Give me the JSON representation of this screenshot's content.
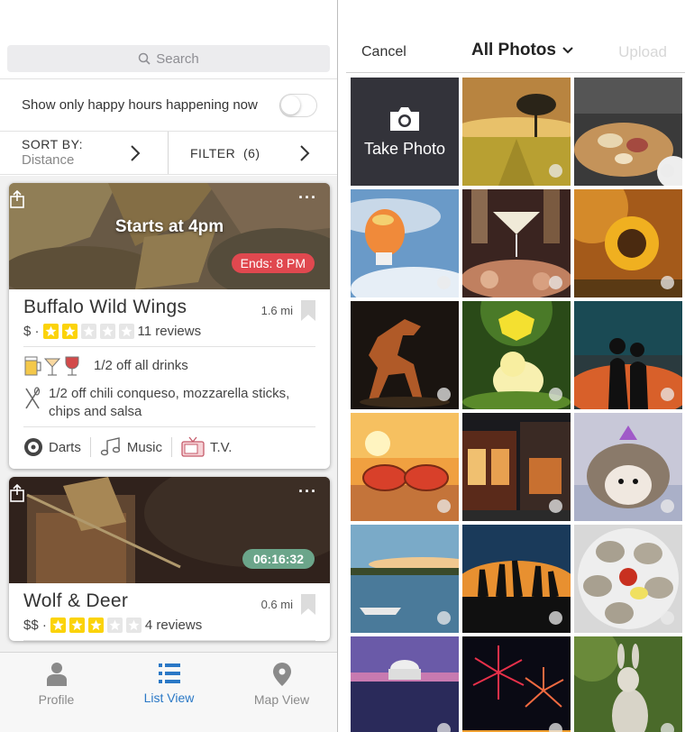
{
  "left": {
    "search": {
      "placeholder": "Search"
    },
    "toggle": {
      "label": "Show only happy hours happening now",
      "on": false
    },
    "sort": {
      "label": "SORT BY:",
      "value": "Distance"
    },
    "filter": {
      "label": "FILTER",
      "count": "(6)"
    },
    "cards": [
      {
        "overlay": "Starts at 4pm",
        "badge": "Ends: 8 PM",
        "name": "Buffalo Wild Wings",
        "distance": "1.6 mi",
        "price": "$ ·",
        "rating": 2,
        "reviews": "11 reviews",
        "deals": [
          "1/2 off all drinks",
          "1/2 off chili conqueso, mozzarella sticks, chips and salsa"
        ],
        "amenities": [
          "Darts",
          "Music",
          "T.V."
        ]
      },
      {
        "badge": "06:16:32",
        "name": "Wolf & Deer",
        "distance": "0.6 mi",
        "price": "$$ ·",
        "rating": 3,
        "reviews": "4 reviews"
      }
    ],
    "tabs": [
      {
        "label": "Profile",
        "icon": "person-icon"
      },
      {
        "label": "List View",
        "icon": "list-icon",
        "active": true
      },
      {
        "label": "Map View",
        "icon": "map-pin-icon"
      }
    ]
  },
  "right": {
    "cancel": "Cancel",
    "title": "All Photos",
    "upload": "Upload",
    "take_photo": "Take Photo",
    "photos": [
      "wheat field with tree at sunset",
      "charcuterie board",
      "inflatable baby balloon",
      "cocktails and food",
      "sunflower",
      "dinosaur model",
      "duckling under daffodil",
      "couple silhouette at sunset",
      "sunglasses on beach",
      "restaurant facade at night",
      "hedgehog with party hat",
      "boats on lake",
      "crowd at sunset",
      "oysters on plate",
      "Jefferson memorial at dusk",
      "fireworks",
      "rabbit statue"
    ]
  },
  "colors": {
    "accent": "#2a78c6",
    "ends_badge": "#e0484f",
    "timer_badge": "#6ba58a",
    "star": "#fbd30a"
  }
}
